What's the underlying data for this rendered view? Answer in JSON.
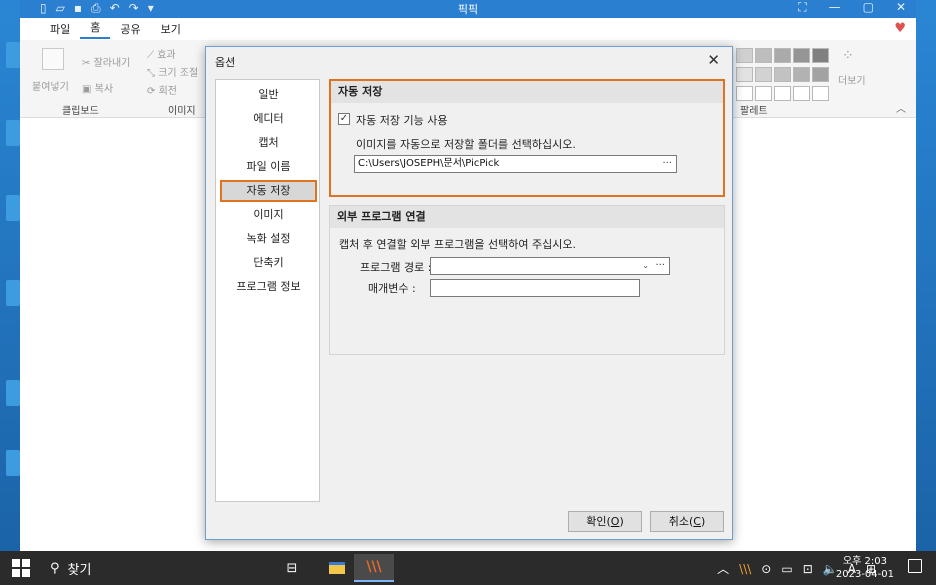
{
  "app": {
    "title": "픽픽",
    "tabs": [
      "파일",
      "홈",
      "공유",
      "보기"
    ],
    "ribbon": {
      "items": [
        "붙여넣기",
        "잘라내기",
        "복사",
        "효과",
        "크기 조절",
        "회전",
        "더보기"
      ],
      "groups": [
        "클립보드",
        "이미지",
        "팔레트"
      ]
    }
  },
  "dialog": {
    "title": "옵션",
    "nav": [
      "일반",
      "에디터",
      "캡처",
      "파일 이름",
      "자동 저장",
      "이미지",
      "녹화 설정",
      "단축키",
      "프로그램 정보"
    ],
    "selected_index": 4,
    "autosave": {
      "header": "자동 저장",
      "checkbox_label": "자동 저장 기능 사용",
      "checked": true,
      "description": "이미지를 자동으로 저장할 폴더를 선택하십시오.",
      "path": "C:\\Users\\JOSEPH\\문서\\PicPick",
      "browse": "···"
    },
    "external": {
      "header": "외부 프로그램 연결",
      "description": "캡처 후 연결할 외부 프로그램을 선택하여 주십시오.",
      "program_path_label": "프로그램 경로 :",
      "program_path_value": "",
      "dropdown": "⌄",
      "browse": "···",
      "params_label": "매개변수 :",
      "params_value": ""
    },
    "ok_label": "확인",
    "ok_key": "O",
    "cancel_label": "취소",
    "cancel_key": "C"
  },
  "taskbar": {
    "search_label": "찾기",
    "ime": "A",
    "time": "오후 2:03",
    "date": "2023-04-01"
  }
}
